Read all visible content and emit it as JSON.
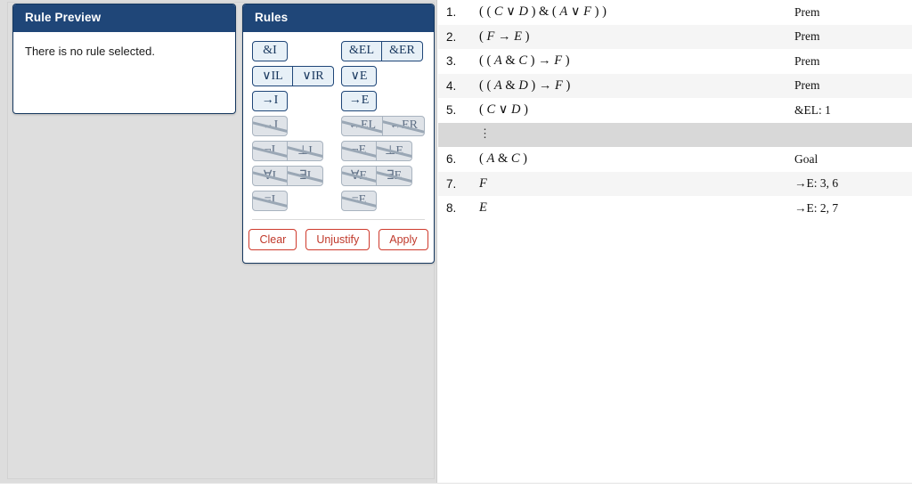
{
  "colors": {
    "header_navy": "#1f4678",
    "panel_gray": "#dddddd",
    "rule_btn_bg": "#e7f0f7",
    "rule_btn_disabled_bg": "#dfe3e8",
    "action_red": "#cf3a2c",
    "row_stripe": "#f5f5f5",
    "ellipsis_row": "#d8d8d8"
  },
  "rule_preview": {
    "title": "Rule Preview",
    "message": "There is no rule selected."
  },
  "rules": {
    "title": "Rules",
    "left_column": [
      {
        "group": [
          "&I"
        ],
        "enabled": [
          true
        ]
      },
      {
        "group": [
          "∨IL",
          "∨IR"
        ],
        "enabled": [
          true,
          true
        ]
      },
      {
        "group": [
          "→I"
        ],
        "enabled": [
          true
        ]
      },
      {
        "group": [
          "↔I"
        ],
        "enabled": [
          false
        ]
      },
      {
        "group": [
          "¬I",
          "⊥I"
        ],
        "enabled": [
          false,
          false
        ]
      },
      {
        "group": [
          "∀I",
          "∃I"
        ],
        "enabled": [
          false,
          false
        ]
      },
      {
        "group": [
          "=I"
        ],
        "enabled": [
          false
        ]
      }
    ],
    "right_column": [
      {
        "group": [
          "&EL",
          "&ER"
        ],
        "enabled": [
          true,
          true
        ]
      },
      {
        "group": [
          "∨E"
        ],
        "enabled": [
          true
        ]
      },
      {
        "group": [
          "→E"
        ],
        "enabled": [
          true
        ]
      },
      {
        "group": [
          "↔EL",
          "↔ER"
        ],
        "enabled": [
          false,
          false
        ]
      },
      {
        "group": [
          "¬E",
          "⊥E"
        ],
        "enabled": [
          false,
          false
        ]
      },
      {
        "group": [
          "∀E",
          "∃E"
        ],
        "enabled": [
          false,
          false
        ]
      },
      {
        "group": [
          "=E"
        ],
        "enabled": [
          false
        ]
      }
    ],
    "actions": {
      "clear": "Clear",
      "unjustify": "Unjustify",
      "apply": "Apply"
    }
  },
  "proof": {
    "rows": [
      {
        "number": "1.",
        "formula": "( ( C ∨ D ) & ( A ∨ F ) )",
        "justification": "Prem",
        "kind": "line"
      },
      {
        "number": "2.",
        "formula": "( F → E )",
        "justification": "Prem",
        "kind": "line"
      },
      {
        "number": "3.",
        "formula": "( ( A & C ) → F )",
        "justification": "Prem",
        "kind": "line"
      },
      {
        "number": "4.",
        "formula": "( ( A & D ) → F )",
        "justification": "Prem",
        "kind": "line"
      },
      {
        "number": "5.",
        "formula": "( C ∨ D )",
        "justification": "&EL: 1",
        "kind": "line"
      },
      {
        "number": "",
        "formula": "⋮",
        "justification": "",
        "kind": "ellipsis"
      },
      {
        "number": "6.",
        "formula": "( A & C )",
        "justification": "Goal",
        "kind": "line"
      },
      {
        "number": "7.",
        "formula": "F",
        "justification": "→E: 3, 6",
        "kind": "line"
      },
      {
        "number": "8.",
        "formula": "E",
        "justification": "→E: 2, 7",
        "kind": "line"
      }
    ]
  }
}
